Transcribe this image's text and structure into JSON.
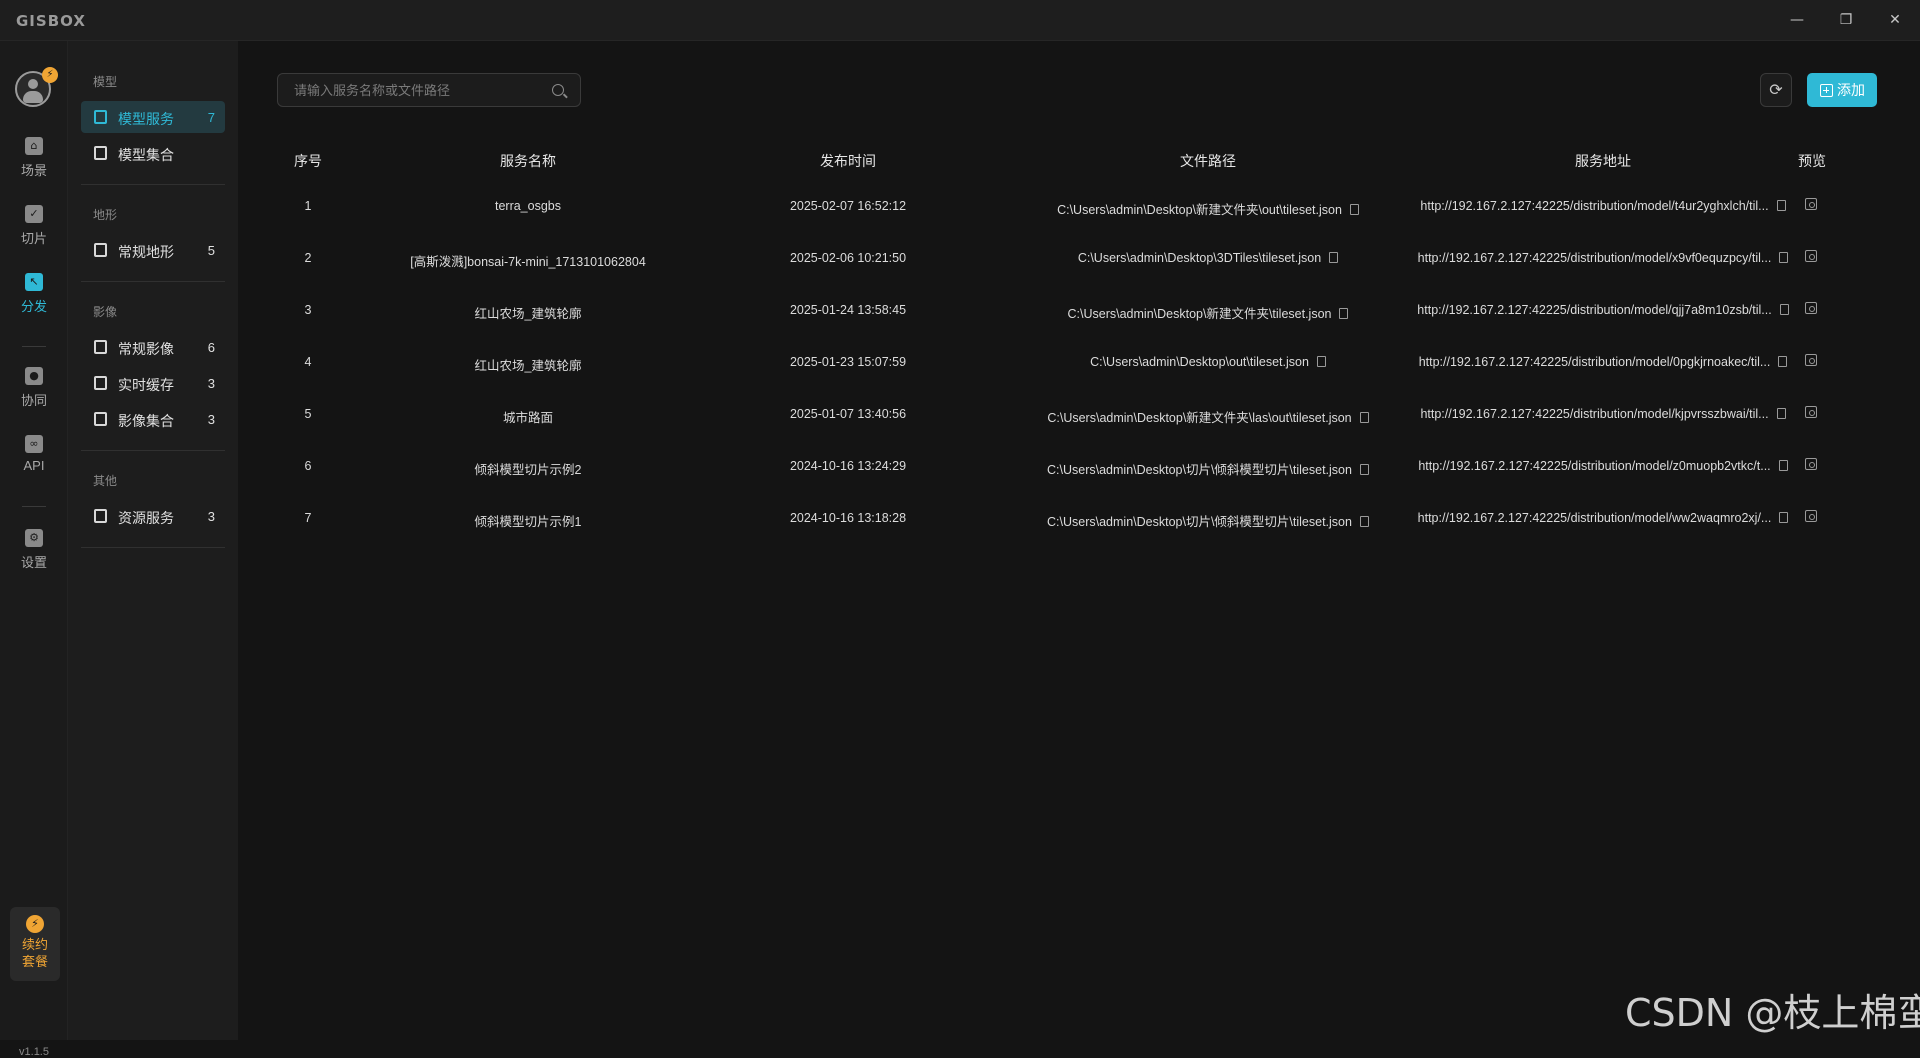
{
  "app": {
    "logo": "GISBOX"
  },
  "window_controls": {
    "minimize": "—",
    "restore": "❐",
    "close": "✕"
  },
  "rail": {
    "badge": "⚡",
    "items": [
      {
        "label": "场景",
        "icon": "home-icon",
        "glyph": "⌂"
      },
      {
        "label": "切片",
        "icon": "slice-icon",
        "glyph": "✓"
      },
      {
        "label": "分发",
        "icon": "distribute-icon",
        "glyph": "↖"
      },
      {
        "label": "协同",
        "icon": "lock-icon",
        "glyph": "●"
      },
      {
        "label": "API",
        "icon": "link-icon",
        "glyph": "∞"
      },
      {
        "label": "设置",
        "icon": "gear-icon",
        "glyph": "⚙"
      }
    ],
    "renew": {
      "glyph": "⚡",
      "label": "续约套餐"
    },
    "version": "v1.1.5"
  },
  "subnav": {
    "groups": [
      {
        "title": "模型",
        "items": [
          {
            "label": "模型服务",
            "count": "7"
          },
          {
            "label": "模型集合",
            "count": ""
          }
        ]
      },
      {
        "title": "地形",
        "items": [
          {
            "label": "常规地形",
            "count": "5"
          }
        ]
      },
      {
        "title": "影像",
        "items": [
          {
            "label": "常规影像",
            "count": "6"
          },
          {
            "label": "实时缓存",
            "count": "3"
          },
          {
            "label": "影像集合",
            "count": "3"
          }
        ]
      },
      {
        "title": "其他",
        "items": [
          {
            "label": "资源服务",
            "count": "3"
          }
        ]
      }
    ]
  },
  "toolbar": {
    "search_placeholder": "请输入服务名称或文件路径",
    "refresh_glyph": "⟳",
    "add_label": "添加"
  },
  "table": {
    "headers": {
      "no": "序号",
      "name": "服务名称",
      "time": "发布时间",
      "path": "文件路径",
      "url": "服务地址",
      "preview": "预览"
    },
    "rows": [
      {
        "no": "1",
        "name": "terra_osgbs",
        "time": "2025-02-07 16:52:12",
        "path": "C:\\Users\\admin\\Desktop\\新建文件夹\\out\\tileset.json",
        "url": "http://192.167.2.127:42225/distribution/model/t4ur2yghxlch/til..."
      },
      {
        "no": "2",
        "name": "[高斯泼溅]bonsai-7k-mini_1713101062804",
        "time": "2025-02-06 10:21:50",
        "path": "C:\\Users\\admin\\Desktop\\3DTiles\\tileset.json",
        "url": "http://192.167.2.127:42225/distribution/model/x9vf0equzpcy/til..."
      },
      {
        "no": "3",
        "name": "红山农场_建筑轮廓",
        "time": "2025-01-24 13:58:45",
        "path": "C:\\Users\\admin\\Desktop\\新建文件夹\\tileset.json",
        "url": "http://192.167.2.127:42225/distribution/model/qjj7a8m10zsb/til..."
      },
      {
        "no": "4",
        "name": "红山农场_建筑轮廓",
        "time": "2025-01-23 15:07:59",
        "path": "C:\\Users\\admin\\Desktop\\out\\tileset.json",
        "url": "http://192.167.2.127:42225/distribution/model/0pgkjrnoakec/til..."
      },
      {
        "no": "5",
        "name": "城市路面",
        "time": "2025-01-07 13:40:56",
        "path": "C:\\Users\\admin\\Desktop\\新建文件夹\\las\\out\\tileset.json",
        "url": "http://192.167.2.127:42225/distribution/model/kjpvrsszbwai/til..."
      },
      {
        "no": "6",
        "name": "倾斜模型切片示例2",
        "time": "2024-10-16 13:24:29",
        "path": "C:\\Users\\admin\\Desktop\\切片\\倾斜模型切片\\tileset.json",
        "url": "http://192.167.2.127:42225/distribution/model/z0muopb2vtkc/t..."
      },
      {
        "no": "7",
        "name": "倾斜模型切片示例1",
        "time": "2024-10-16 13:18:28",
        "path": "C:\\Users\\admin\\Desktop\\切片\\倾斜模型切片\\tileset.json",
        "url": "http://192.167.2.127:42225/distribution/model/ww2waqmro2xj/..."
      }
    ]
  },
  "watermark": "CSDN @枝上棉蛮",
  "colors": {
    "accent": "#2fb9d6",
    "warning": "#f0a534",
    "background": "#141414"
  }
}
